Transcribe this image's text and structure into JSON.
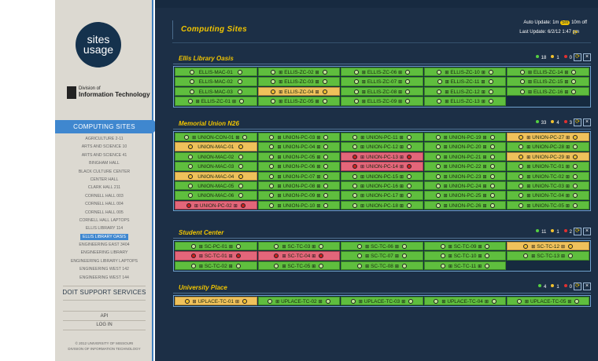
{
  "sidebar": {
    "logo": {
      "line1": "sites",
      "line2": "usage"
    },
    "division": {
      "line1": "Division of",
      "line2": "Information Technology"
    },
    "heading": "COMPUTING SITES",
    "items": [
      "AGRICULTURE 2-11",
      "ARTS AND SCIENCE 10",
      "ARTS AND SCIENCE 41",
      "BINGHAM HALL",
      "BLACK CULTURE CENTER",
      "CENTER HALL",
      "CLARK HALL 211",
      "CORNELL HALL 003",
      "CORNELL HALL 004",
      "CORNELL HALL 005",
      "CORNELL HALL LAPTOPS",
      "ELLIS LIBRARY 114",
      "ELLIS LIBRARY OASIS",
      "ENGINEERING EAST 3404",
      "ENGINEERING LIBRARY",
      "ENGINEERING LIBRARY LAPTOPS",
      "ENGINEERING WEST 142",
      "ENGINEERING WEST 144"
    ],
    "active_item": "ELLIS LIBRARY OASIS",
    "doit": "DOIT SUPPORT SERVICES",
    "api": "API",
    "login": "LOG IN",
    "copyright1": "© 2012 UNIVERSITY OF MISSOURI",
    "copyright2": "DIVISION OF INFORMATION TECHNOLOGY"
  },
  "header": {
    "title": "Computing Sites",
    "auto_update_label": "Auto Update:",
    "auto_update_options": [
      "1m",
      "5m",
      "10m",
      "off"
    ],
    "auto_update_selected": "5m",
    "last_update_label": "Last Update:",
    "last_update_value": "6/2/12 1:47 pm"
  },
  "colors": {
    "accent": "#f0c400",
    "nav": "#3f87cf",
    "background": "#1c2f46",
    "ok": "#5fbe3e",
    "warn": "#efc15b",
    "error": "#e3667a"
  },
  "sections": [
    {
      "title": "Ellis Library Oasis",
      "counts": {
        "green": "18",
        "yellow": "1",
        "red": "0"
      },
      "rows": [
        [
          [
            "ELLIS-MAC-01",
            "mac",
            "g"
          ],
          [
            "ELLIS-ZC-02",
            "win",
            "g"
          ],
          [
            "ELLIS-ZC-06",
            "win",
            "g"
          ],
          [
            "ELLIS-ZC-10",
            "win",
            "g"
          ],
          [
            "ELLIS-ZC-14",
            "win",
            "g"
          ]
        ],
        [
          [
            "ELLIS-MAC-02",
            "mac",
            "g"
          ],
          [
            "ELLIS-ZC-03",
            "win",
            "g"
          ],
          [
            "ELLIS-ZC-07",
            "win",
            "g"
          ],
          [
            "ELLIS-ZC-11",
            "win",
            "g"
          ],
          [
            "ELLIS-ZC-15",
            "win",
            "g"
          ]
        ],
        [
          [
            "ELLIS-MAC-03",
            "mac",
            "g"
          ],
          [
            "ELLIS-ZC-04",
            "win",
            "y"
          ],
          [
            "ELLIS-ZC-08",
            "win",
            "g"
          ],
          [
            "ELLIS-ZC-12",
            "win",
            "g"
          ],
          [
            "ELLIS-ZC-16",
            "win",
            "g"
          ]
        ],
        [
          [
            "ELLIS-ZC-01",
            "win",
            "g"
          ],
          [
            "ELLIS-ZC-05",
            "win",
            "g"
          ],
          [
            "ELLIS-ZC-09",
            "win",
            "g"
          ],
          [
            "ELLIS-ZC-13",
            "win",
            "g"
          ],
          [
            "",
            "",
            "e"
          ]
        ]
      ]
    },
    {
      "title": "Memorial Union N26",
      "counts": {
        "green": "33",
        "yellow": "4",
        "red": "3"
      },
      "rows": [
        [
          [
            "UNION-CON-01",
            "win",
            "g"
          ],
          [
            "UNION-PC-03",
            "win",
            "g"
          ],
          [
            "UNION-PC-11",
            "win",
            "g"
          ],
          [
            "UNION-PC-19",
            "win",
            "g"
          ],
          [
            "UNION-PC-27",
            "win",
            "y"
          ]
        ],
        [
          [
            "UNION-MAC-01",
            "mac",
            "y"
          ],
          [
            "UNION-PC-04",
            "win",
            "g"
          ],
          [
            "UNION-PC-12",
            "win",
            "g"
          ],
          [
            "UNION-PC-20",
            "win",
            "g"
          ],
          [
            "UNION-PC-28",
            "win",
            "g"
          ]
        ],
        [
          [
            "UNION-MAC-02",
            "mac",
            "g"
          ],
          [
            "UNION-PC-05",
            "win",
            "g"
          ],
          [
            "UNION-PC-13",
            "win",
            "r"
          ],
          [
            "UNION-PC-21",
            "win",
            "g"
          ],
          [
            "UNION-PC-29",
            "win",
            "y"
          ]
        ],
        [
          [
            "UNION-MAC-03",
            "mac",
            "g"
          ],
          [
            "UNION-PC-06",
            "win",
            "g"
          ],
          [
            "UNION-PC-14",
            "win",
            "r"
          ],
          [
            "UNION-PC-22",
            "win",
            "g"
          ],
          [
            "UNION-TC-01",
            "win",
            "g"
          ]
        ],
        [
          [
            "UNION-MAC-04",
            "mac",
            "y"
          ],
          [
            "UNION-PC-07",
            "win",
            "g"
          ],
          [
            "UNION-PC-15",
            "win",
            "g"
          ],
          [
            "UNION-PC-23",
            "win",
            "g"
          ],
          [
            "UNION-TC-02",
            "win",
            "g"
          ]
        ],
        [
          [
            "UNION-MAC-05",
            "mac",
            "g"
          ],
          [
            "UNION-PC-08",
            "win",
            "g"
          ],
          [
            "UNION-PC-16",
            "win",
            "g"
          ],
          [
            "UNION-PC-24",
            "win",
            "g"
          ],
          [
            "UNION-TC-03",
            "win",
            "g"
          ]
        ],
        [
          [
            "UNION-MAC-06",
            "mac",
            "g"
          ],
          [
            "UNION-PC-09",
            "win",
            "g"
          ],
          [
            "UNION-PC-17",
            "win",
            "g"
          ],
          [
            "UNION-PC-25",
            "win",
            "g"
          ],
          [
            "UNION-TC-04",
            "win",
            "g"
          ]
        ],
        [
          [
            "UNION-PC-02",
            "win",
            "r"
          ],
          [
            "UNION-PC-10",
            "win",
            "g"
          ],
          [
            "UNION-PC-18",
            "win",
            "g"
          ],
          [
            "UNION-PC-26",
            "win",
            "g"
          ],
          [
            "UNION-TC-05",
            "win",
            "g"
          ]
        ]
      ]
    },
    {
      "title": "Student Center",
      "counts": {
        "green": "11",
        "yellow": "1",
        "red": "2"
      },
      "rows": [
        [
          [
            "SC-PC-01",
            "win",
            "g"
          ],
          [
            "SC-TC-03",
            "win",
            "g"
          ],
          [
            "SC-TC-06",
            "win",
            "g"
          ],
          [
            "SC-TC-09",
            "win",
            "g"
          ],
          [
            "SC-TC-12",
            "win",
            "y"
          ]
        ],
        [
          [
            "SC-TC-01",
            "win",
            "r"
          ],
          [
            "SC-TC-04",
            "win",
            "r"
          ],
          [
            "SC-TC-07",
            "win",
            "g"
          ],
          [
            "SC-TC-10",
            "win",
            "g"
          ],
          [
            "SC-TC-13",
            "win",
            "g"
          ]
        ],
        [
          [
            "SC-TC-02",
            "win",
            "g"
          ],
          [
            "SC-TC-05",
            "win",
            "g"
          ],
          [
            "SC-TC-08",
            "win",
            "g"
          ],
          [
            "SC-TC-11",
            "win",
            "g"
          ],
          [
            "",
            "",
            "e"
          ]
        ]
      ]
    },
    {
      "title": "University Place",
      "counts": {
        "green": "4",
        "yellow": "1",
        "red": "0"
      },
      "rows": [
        [
          [
            "UPLACE-TC-01",
            "win",
            "y"
          ],
          [
            "UPLACE-TC-02",
            "win",
            "g"
          ],
          [
            "UPLACE-TC-03",
            "win",
            "g"
          ],
          [
            "UPLACE-TC-04",
            "win",
            "g"
          ],
          [
            "UPLACE-TC-05",
            "win",
            "g"
          ]
        ]
      ]
    }
  ]
}
